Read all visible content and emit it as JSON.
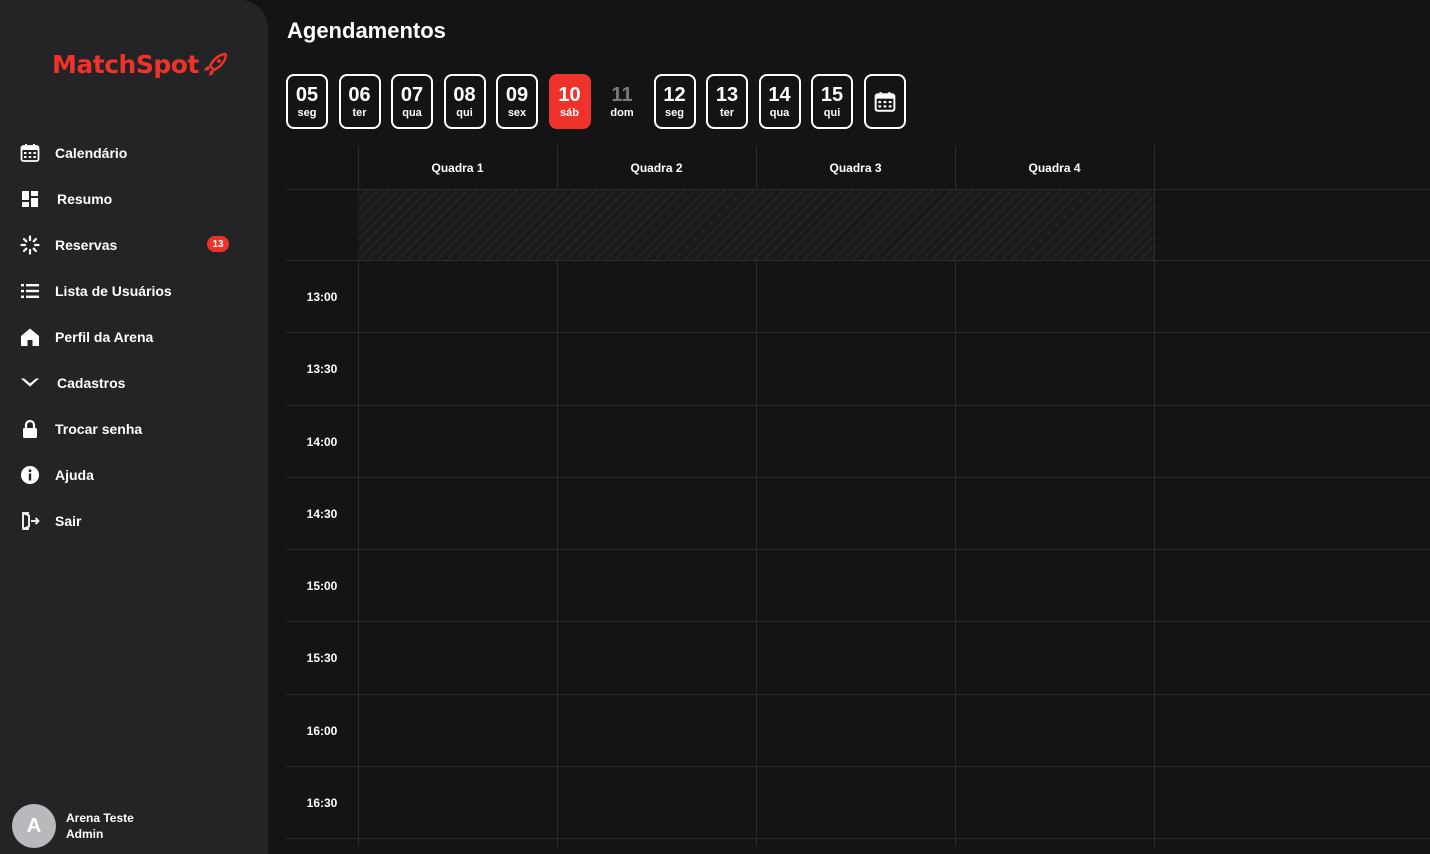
{
  "brand": {
    "logo_text": "MatchSpot",
    "accent": "#f0332a"
  },
  "sidebar": {
    "items": [
      {
        "label": "Calendário",
        "icon": "calendar-icon"
      },
      {
        "label": "Resumo",
        "icon": "dashboard-icon"
      },
      {
        "label": "Reservas",
        "icon": "spinner-icon",
        "badge": "13"
      },
      {
        "label": "Lista de Usuários",
        "icon": "list-icon"
      },
      {
        "label": "Perfil da Arena",
        "icon": "home-icon"
      },
      {
        "label": "Cadastros",
        "icon": "chevron-down-icon"
      },
      {
        "label": "Trocar senha",
        "icon": "lock-icon"
      },
      {
        "label": "Ajuda",
        "icon": "info-icon"
      },
      {
        "label": "Sair",
        "icon": "logout-icon"
      }
    ]
  },
  "user": {
    "initial": "A",
    "name": "Arena Teste",
    "role": "Admin"
  },
  "main": {
    "title": "Agendamentos",
    "days": [
      {
        "num": "05",
        "wd": "seg"
      },
      {
        "num": "06",
        "wd": "ter"
      },
      {
        "num": "07",
        "wd": "qua"
      },
      {
        "num": "08",
        "wd": "qui"
      },
      {
        "num": "09",
        "wd": "sex"
      },
      {
        "num": "10",
        "wd": "sáb",
        "state": "active"
      },
      {
        "num": "11",
        "wd": "dom",
        "state": "off"
      },
      {
        "num": "12",
        "wd": "seg"
      },
      {
        "num": "13",
        "wd": "ter"
      },
      {
        "num": "14",
        "wd": "qua"
      },
      {
        "num": "15",
        "wd": "qui"
      }
    ],
    "calendar_button_icon": "calendar-icon",
    "courts": [
      "Quadra 1",
      "Quadra 2",
      "Quadra 3",
      "Quadra 4"
    ],
    "times": [
      "13:00",
      "13:30",
      "14:00",
      "14:30",
      "15:00",
      "15:30",
      "16:00",
      "16:30"
    ]
  }
}
